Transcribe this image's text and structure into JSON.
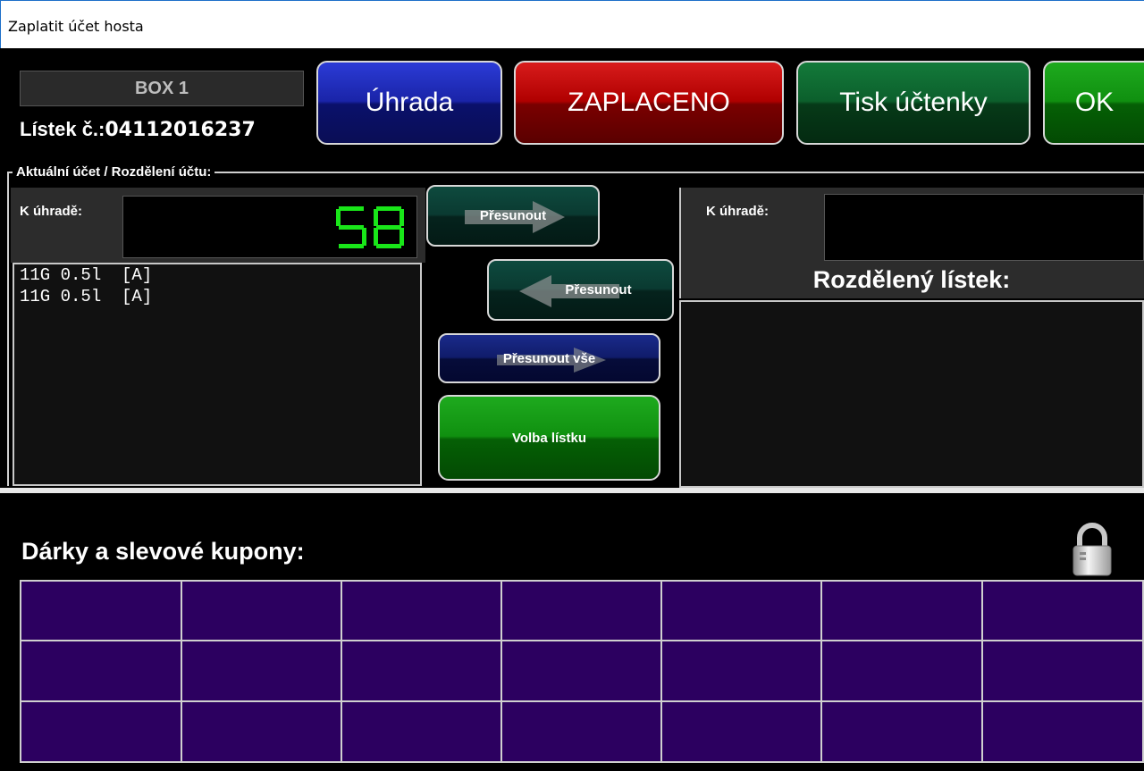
{
  "window": {
    "title": "Zaplatit účet hosta"
  },
  "header": {
    "box_label": "BOX 1",
    "ticket_label": "Lístek č.:",
    "ticket_number": "04112016237"
  },
  "toolbar": {
    "payment_label": "Úhrada",
    "paid_label": "ZAPLACENO",
    "print_label": "Tisk účtenky",
    "ok_label": "OK"
  },
  "section": {
    "title": "Aktuální účet / Rozdělení účtu:"
  },
  "left_panel": {
    "amount_label": "K úhradě:",
    "amount_value": "58",
    "items": [
      "11G 0.5l  [A]",
      "11G 0.5l  [A]"
    ]
  },
  "middle": {
    "move_right_label": "Přesunout",
    "move_left_label": "Přesunout",
    "move_all_label": "Přesunout vše",
    "select_ticket_label": "Volba lístku"
  },
  "right_panel": {
    "amount_label": "K úhradě:",
    "amount_value": "",
    "split_title": "Rozdělený lístek:",
    "items": []
  },
  "gifts": {
    "title": "Dárky a slevové kupony:",
    "lock_icon": "padlock-icon",
    "rows": 3,
    "cols": 7
  },
  "colors": {
    "coupon_tile": "#2c0060",
    "lcd_digit": "#19e619",
    "paid": "#b00000",
    "payment": "#1a24a8"
  }
}
